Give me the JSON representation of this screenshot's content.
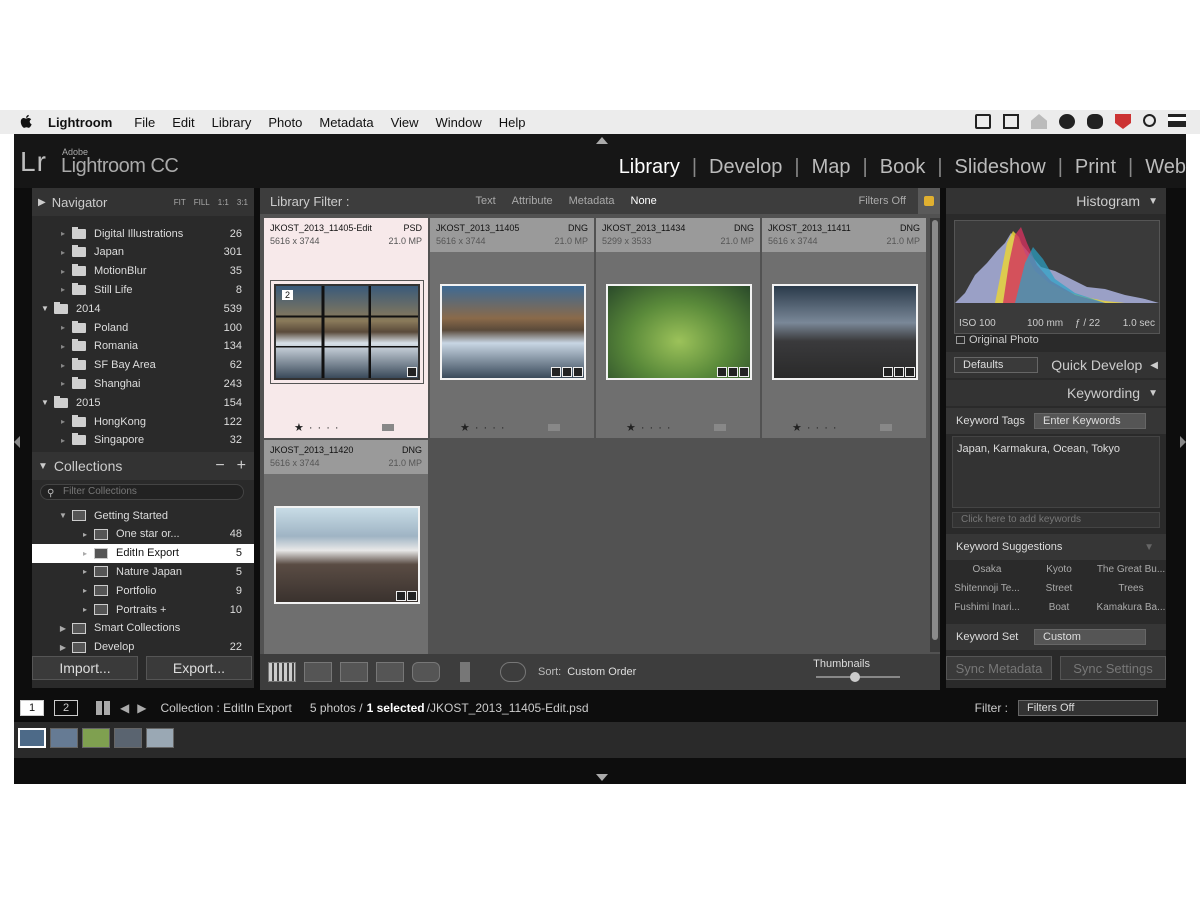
{
  "menubar": {
    "app": "Lightroom",
    "items": [
      "File",
      "Edit",
      "Library",
      "Photo",
      "Metadata",
      "View",
      "Window",
      "Help"
    ]
  },
  "identity": {
    "lr": "Lr",
    "adobe": "Adobe",
    "product": "Lightroom CC"
  },
  "modules": [
    "Library",
    "Develop",
    "Map",
    "Book",
    "Slideshow",
    "Print",
    "Web"
  ],
  "navigator": {
    "title": "Navigator",
    "options": [
      "FIT",
      "FILL",
      "1:1",
      "3:1"
    ]
  },
  "folders": [
    {
      "label": "Digital Illustrations",
      "count": "26",
      "level": 2
    },
    {
      "label": "Japan",
      "count": "301",
      "level": 2
    },
    {
      "label": "MotionBlur",
      "count": "35",
      "level": 2
    },
    {
      "label": "Still Life",
      "count": "8",
      "level": 2
    },
    {
      "label": "2014",
      "count": "539",
      "level": 1
    },
    {
      "label": "Poland",
      "count": "100",
      "level": 2
    },
    {
      "label": "Romania",
      "count": "134",
      "level": 2
    },
    {
      "label": "SF Bay Area",
      "count": "62",
      "level": 2
    },
    {
      "label": "Shanghai",
      "count": "243",
      "level": 2
    },
    {
      "label": "2015",
      "count": "154",
      "level": 1
    },
    {
      "label": "HongKong",
      "count": "122",
      "level": 2
    },
    {
      "label": "Singapore",
      "count": "32",
      "level": 2
    }
  ],
  "collections": {
    "title": "Collections",
    "filter_placeholder": "Filter Collections",
    "items": [
      {
        "label": "Getting Started",
        "count": "",
        "level": 1
      },
      {
        "label": "One star or...",
        "count": "48",
        "level": 2
      },
      {
        "label": "EditIn Export",
        "count": "5",
        "level": 2,
        "selected": true
      },
      {
        "label": "Nature Japan",
        "count": "5",
        "level": 2
      },
      {
        "label": "Portfolio",
        "count": "9",
        "level": 2
      },
      {
        "label": "Portraits +",
        "count": "10",
        "level": 2
      },
      {
        "label": "Smart Collections",
        "count": "",
        "level": 1
      },
      {
        "label": "Develop",
        "count": "22",
        "level": 1
      }
    ]
  },
  "buttons": {
    "import": "Import...",
    "export": "Export...",
    "sync_metadata": "Sync Metadata",
    "sync_settings": "Sync Settings"
  },
  "libfilter": {
    "title": "Library Filter :",
    "filters": [
      "Text",
      "Attribute",
      "Metadata",
      "None"
    ],
    "state": "Filters Off"
  },
  "photos": [
    {
      "name": "JKOST_2013_11405-Edit",
      "ext": "PSD",
      "dims": "5616 x 3744",
      "mp": "21.0 MP",
      "index": "2",
      "selected": true
    },
    {
      "name": "JKOST_2013_11405",
      "ext": "DNG",
      "dims": "5616 x 3744",
      "mp": "21.0 MP"
    },
    {
      "name": "JKOST_2013_11434",
      "ext": "DNG",
      "dims": "5299 x 3533",
      "mp": "21.0 MP"
    },
    {
      "name": "JKOST_2013_11411",
      "ext": "DNG",
      "dims": "5616 x 3744",
      "mp": "21.0 MP"
    },
    {
      "name": "JKOST_2013_11420",
      "ext": "DNG",
      "dims": "5616 x 3744",
      "mp": "21.0 MP"
    }
  ],
  "toolbar": {
    "sort_label": "Sort:",
    "sort_value": "Custom Order",
    "thumbnails": "Thumbnails"
  },
  "histogram": {
    "title": "Histogram",
    "iso": "ISO 100",
    "focal": "100 mm",
    "aperture": "ƒ / 22",
    "shutter": "1.0 sec",
    "original": "Original Photo"
  },
  "quickdev": {
    "title": "Quick Develop",
    "preset": "Defaults"
  },
  "keywording": {
    "title": "Keywording",
    "tags_label": "Keyword Tags",
    "tags_mode": "Enter Keywords",
    "keywords": "Japan, Karmakura, Ocean, Tokyo",
    "add_placeholder": "Click here to add keywords",
    "suggestions_title": "Keyword Suggestions",
    "suggestions": [
      "Osaka",
      "Kyoto",
      "The Great Bu...",
      "Shitennoji Te...",
      "Street",
      "Trees",
      "Fushimi Inari...",
      "Boat",
      "Kamakura Ba..."
    ],
    "set_label": "Keyword Set",
    "set_value": "Custom"
  },
  "filmstrip": {
    "page1": "1",
    "page2": "2",
    "collection": "Collection : EditIn Export",
    "count": "5 photos /",
    "selected": "1 selected",
    "file": "/JKOST_2013_11405-Edit.psd",
    "filter_label": "Filter :",
    "filter_value": "Filters Off"
  }
}
